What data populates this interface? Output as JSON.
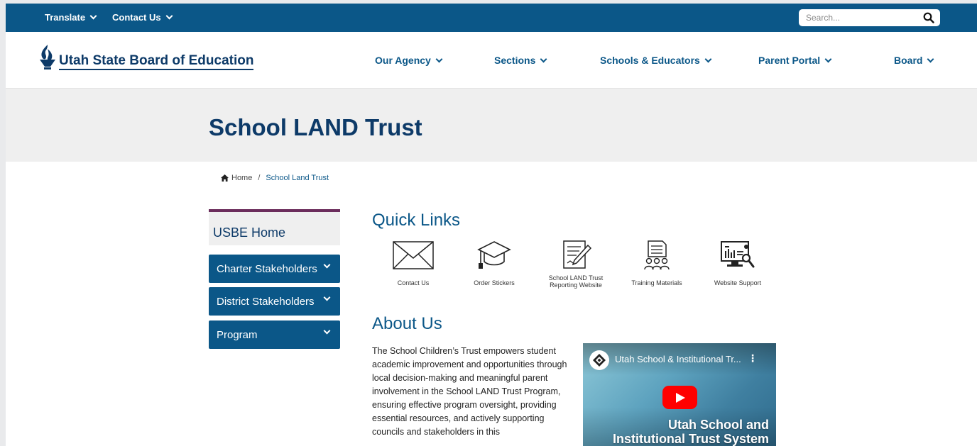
{
  "topbar": {
    "translate": "Translate",
    "contact": "Contact Us",
    "search_placeholder": "Search..."
  },
  "logo": {
    "text": "Utah State Board of Education"
  },
  "nav": {
    "items": [
      "Our Agency",
      "Sections",
      "Schools & Educators",
      "Parent Portal",
      "Board"
    ]
  },
  "page": {
    "title": "School LAND Trust"
  },
  "breadcrumb": {
    "home": "Home",
    "separator": "/",
    "current": "School Land Trust"
  },
  "sidebar": {
    "home": "USBE Home",
    "items": [
      "Charter Stakeholders",
      "District Stakeholders",
      "Program"
    ]
  },
  "quick_links": {
    "heading": "Quick Links",
    "items": [
      {
        "label": "Contact Us",
        "icon": "envelope-icon"
      },
      {
        "label": "Order Stickers",
        "icon": "graduation-cap-icon"
      },
      {
        "label": "School LAND Trust Reporting Website",
        "icon": "document-pencil-icon"
      },
      {
        "label": "Training Materials",
        "icon": "people-document-icon"
      },
      {
        "label": "Website Support",
        "icon": "monitor-support-icon"
      }
    ]
  },
  "about": {
    "heading": "About Us",
    "text": "The School Children’s Trust empowers student academic improvement and opportunities through local decision-making and meaningful parent involvement in the School LAND Trust Program, ensuring effective program oversight, providing essential resources, and actively supporting councils and stakeholders in this"
  },
  "video": {
    "title": "Utah School & Institutional Tr...",
    "overlay_line1": "Utah School and",
    "overlay_line2": "Institutional Trust System"
  },
  "colors": {
    "primary": "#0b5788",
    "dark_blue": "#0d3a68",
    "accent": "#6b2d5c",
    "band": "#efefef"
  }
}
